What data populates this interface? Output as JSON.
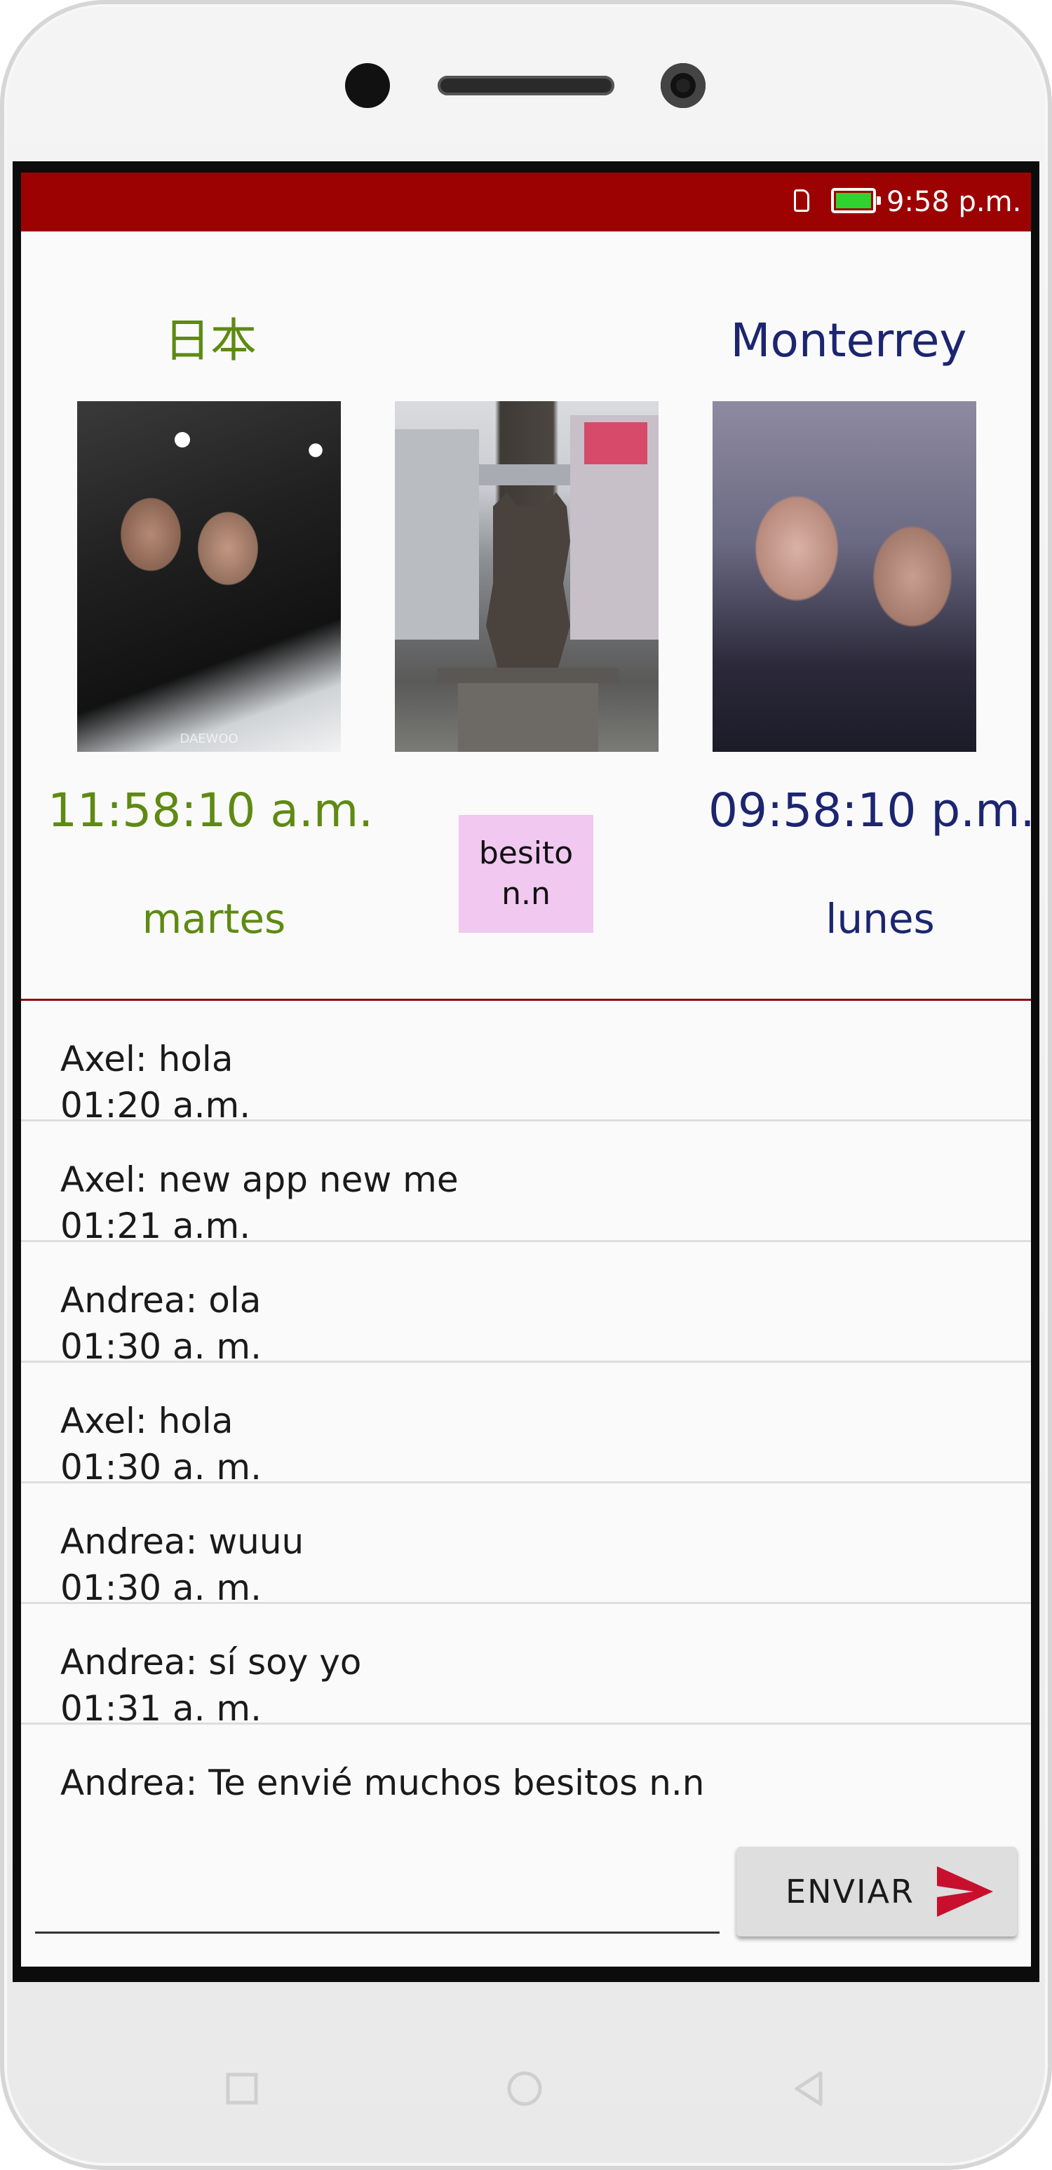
{
  "status_bar": {
    "time": "9:58 p.m.",
    "icons": [
      "sim-card-icon",
      "battery-icon"
    ],
    "background_color": "#9d0202",
    "battery_color": "#2fd22f"
  },
  "clocks": {
    "left": {
      "place": "日本",
      "time": "11:58:10 a.m.",
      "day": "martes",
      "color": "#5e8a12"
    },
    "right": {
      "place": "Monterrey",
      "time": "09:58:10 p.m.",
      "day": "lunes",
      "color": "#1c2570"
    },
    "kiss_button": {
      "line1": "besito",
      "line2": "n.n",
      "color": "#f0c8f0"
    },
    "photos": [
      {
        "label": "DAEWOO"
      },
      {
        "label": ""
      },
      {
        "label": ""
      }
    ]
  },
  "messages": [
    {
      "text": "Axel: hola",
      "time": "01:20 a.m."
    },
    {
      "text": "Axel: new app new me",
      "time": "01:21 a.m."
    },
    {
      "text": "Andrea: ola",
      "time": "01:30 a. m."
    },
    {
      "text": "Axel: hola",
      "time": "01:30 a. m."
    },
    {
      "text": "Andrea: wuuu",
      "time": "01:30 a. m."
    },
    {
      "text": "Andrea: sí soy yo",
      "time": "01:31 a. m."
    },
    {
      "text": "Andrea: Te envié muchos besitos n.n",
      "time": ""
    }
  ],
  "composer": {
    "input_value": "",
    "send_label": "ENVIAR",
    "send_icon": "send-arrow-icon",
    "send_icon_color": "#c8102e"
  },
  "nav_bar": {
    "icons": [
      "recent-apps-icon",
      "home-icon",
      "back-icon"
    ]
  }
}
